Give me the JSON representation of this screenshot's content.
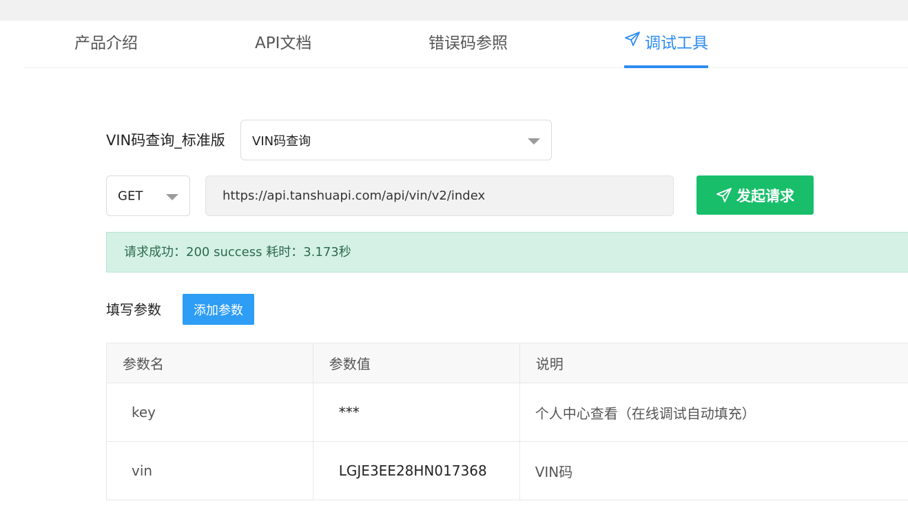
{
  "tabs": [
    {
      "label": "产品介绍",
      "active": false
    },
    {
      "label": "API文档",
      "active": false
    },
    {
      "label": "错误码参照",
      "active": false
    },
    {
      "label": "调试工具",
      "active": true,
      "icon": "paper-plane-icon"
    }
  ],
  "api": {
    "name_label": "VIN码查询_标准版",
    "endpoint_select": "VIN码查询",
    "method": "GET",
    "url": "https://api.tanshuapi.com/api/vin/v2/index",
    "send_label": "发起请求",
    "send_icon": "paper-plane-icon"
  },
  "result": {
    "message": "请求成功：200 success 耗时：3.173秒"
  },
  "params": {
    "title": "填写参数",
    "add_label": "添加参数",
    "headers": [
      "参数名",
      "参数值",
      "说明"
    ],
    "rows": [
      {
        "name": "key",
        "value": "***",
        "desc": "个人中心查看（在线调试自动填充）"
      },
      {
        "name": "vin",
        "value": "LGJE3EE28HN017368",
        "desc": "VIN码"
      }
    ]
  },
  "colors": {
    "accent": "#2d8cf0",
    "send_button": "#19be6b",
    "success_bg": "#d5f1e6",
    "add_button": "#2d9df5"
  }
}
